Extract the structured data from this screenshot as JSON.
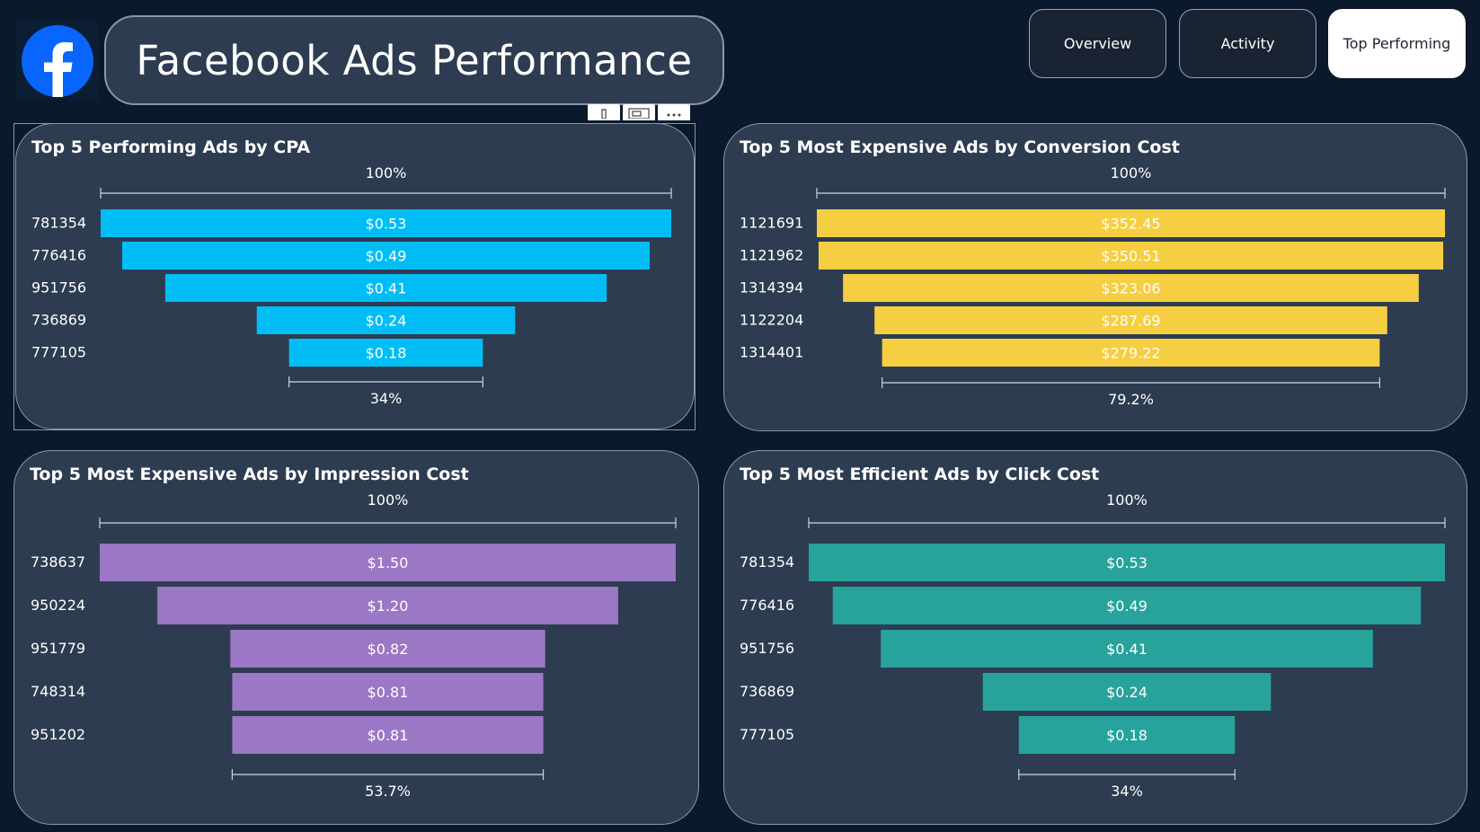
{
  "header": {
    "logo_icon": "facebook-logo-icon",
    "title": "Facebook Ads Performance",
    "nav": [
      {
        "label": "Overview",
        "active": false
      },
      {
        "label": "Activity",
        "active": false
      },
      {
        "label": "Top Performing",
        "active": true
      }
    ],
    "visual_toolbar_icons": [
      "filter-icon",
      "focus-mode-icon",
      "more-options-icon"
    ]
  },
  "colors": {
    "page_background": "#0a192b",
    "panel_background": "#2d3c50",
    "panel_border": "#8c97a8",
    "cpa_bar": "#00bef5",
    "conversion_bar": "#f5ce42",
    "impression_bar": "#9a78c5",
    "click_bar": "#27a39b",
    "active_nav_background": "#ffffff"
  },
  "chart_data": [
    {
      "type": "funnel",
      "title": "Top 5 Performing Ads by CPA",
      "categories": [
        "781354",
        "776416",
        "951756",
        "736869",
        "777105"
      ],
      "values": [
        0.53,
        0.49,
        0.41,
        0.24,
        0.18
      ],
      "data_labels": [
        "$0.53",
        "$0.49",
        "$0.41",
        "$0.24",
        "$0.18"
      ],
      "top_percent_label": "100%",
      "bottom_percent_label": "34%",
      "color": "#00bef5"
    },
    {
      "type": "funnel",
      "title": "Top 5 Most Expensive Ads by Conversion Cost",
      "categories": [
        "1121691",
        "1121962",
        "1314394",
        "1122204",
        "1314401"
      ],
      "values": [
        352.45,
        350.51,
        323.06,
        287.69,
        279.22
      ],
      "data_labels": [
        "$352.45",
        "$350.51",
        "$323.06",
        "$287.69",
        "$279.22"
      ],
      "top_percent_label": "100%",
      "bottom_percent_label": "79.2%",
      "color": "#f5ce42"
    },
    {
      "type": "funnel",
      "title": "Top 5 Most Expensive Ads by Impression Cost",
      "categories": [
        "738637",
        "950224",
        "951779",
        "748314",
        "951202"
      ],
      "values": [
        1.5,
        1.2,
        0.82,
        0.81,
        0.81
      ],
      "data_labels": [
        "$1.50",
        "$1.20",
        "$0.82",
        "$0.81",
        "$0.81"
      ],
      "top_percent_label": "100%",
      "bottom_percent_label": "53.7%",
      "color": "#9a78c5"
    },
    {
      "type": "funnel",
      "title": "Top 5 Most Efficient Ads by Click Cost",
      "categories": [
        "781354",
        "776416",
        "951756",
        "736869",
        "777105"
      ],
      "values": [
        0.53,
        0.49,
        0.41,
        0.24,
        0.18
      ],
      "data_labels": [
        "$0.53",
        "$0.49",
        "$0.41",
        "$0.24",
        "$0.18"
      ],
      "top_percent_label": "100%",
      "bottom_percent_label": "34%",
      "color": "#27a39b"
    }
  ]
}
